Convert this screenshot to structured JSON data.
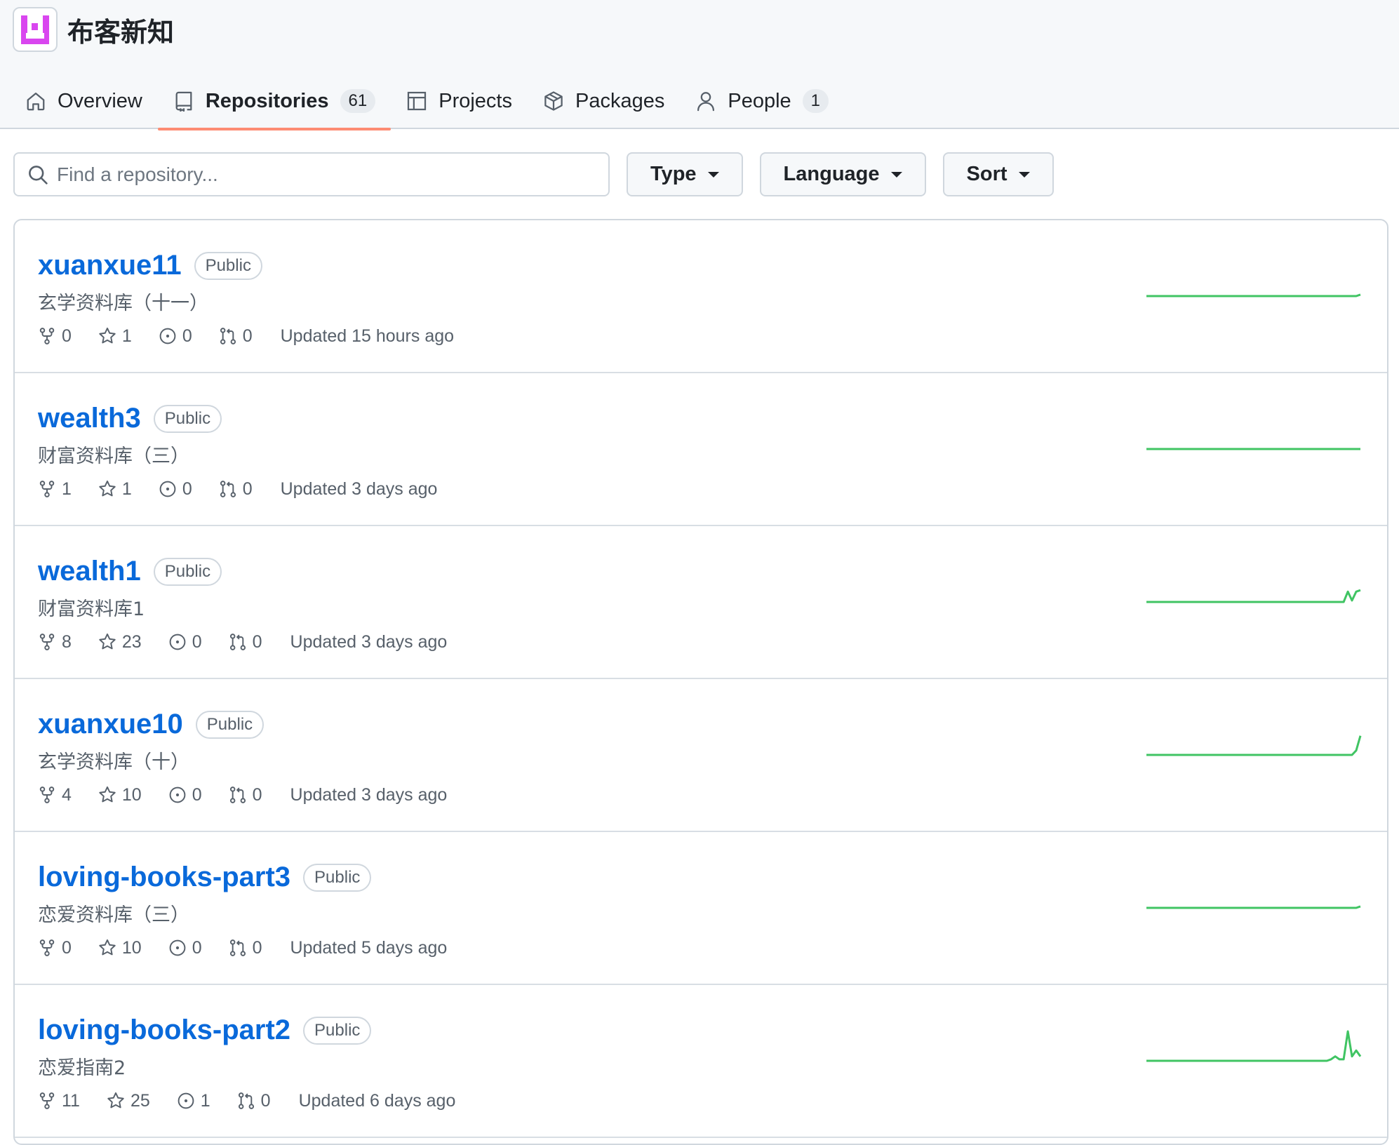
{
  "org": {
    "name": "布客新知",
    "logo_icon": "org-logo-icon"
  },
  "nav": {
    "tabs": [
      {
        "label": "Overview",
        "icon": "home-icon"
      },
      {
        "label": "Repositories",
        "icon": "repo-icon",
        "count": "61",
        "selected": true
      },
      {
        "label": "Projects",
        "icon": "table-icon"
      },
      {
        "label": "Packages",
        "icon": "package-icon"
      },
      {
        "label": "People",
        "icon": "person-icon",
        "count": "1"
      }
    ]
  },
  "filters": {
    "search_placeholder": "Find a repository...",
    "type_label": "Type",
    "language_label": "Language",
    "sort_label": "Sort"
  },
  "repos": [
    {
      "name": "xuanxue11",
      "visibility": "Public",
      "description": "玄学资料库（十一）",
      "forks": "0",
      "stars": "1",
      "issues": "0",
      "pulls": "0",
      "updated": "Updated 15 hours ago",
      "activity": [
        0,
        0,
        0,
        0,
        0,
        0,
        0,
        0,
        0,
        0,
        0,
        0,
        0,
        0,
        0,
        0,
        0,
        0,
        0,
        0,
        0,
        0,
        0,
        0,
        0,
        0,
        0,
        0,
        0,
        0,
        0,
        0,
        0,
        0,
        0,
        0,
        0,
        0,
        0,
        0,
        0,
        0,
        0,
        0,
        0,
        0,
        0,
        0,
        0,
        0,
        0,
        1
      ]
    },
    {
      "name": "wealth3",
      "visibility": "Public",
      "description": "财富资料库（三）",
      "forks": "1",
      "stars": "1",
      "issues": "0",
      "pulls": "0",
      "updated": "Updated 3 days ago",
      "activity": [
        0,
        0,
        0,
        0,
        0,
        0,
        0,
        0,
        0,
        0,
        0,
        0,
        0,
        0,
        0,
        0,
        0,
        0,
        0,
        0,
        0,
        0,
        0,
        0,
        0,
        0,
        0,
        0,
        0,
        0,
        0,
        0,
        0,
        0,
        0,
        0,
        0,
        0,
        0,
        0,
        0,
        0,
        0,
        0,
        0,
        0,
        0,
        0,
        0,
        0,
        0,
        0
      ]
    },
    {
      "name": "wealth1",
      "visibility": "Public",
      "description": "财富资料库1",
      "forks": "8",
      "stars": "23",
      "issues": "0",
      "pulls": "0",
      "updated": "Updated 3 days ago",
      "activity": [
        0,
        0,
        0,
        0,
        0,
        0,
        0,
        0,
        0,
        0,
        0,
        0,
        0,
        0,
        0,
        0,
        0,
        0,
        0,
        0,
        0,
        0,
        0,
        0,
        0,
        0,
        0,
        0,
        0,
        0,
        0,
        0,
        0,
        0,
        0,
        0,
        0,
        0,
        0,
        0,
        0,
        0,
        0,
        0,
        0,
        0,
        0,
        0,
        7,
        1,
        7,
        8
      ]
    },
    {
      "name": "xuanxue10",
      "visibility": "Public",
      "description": "玄学资料库（十）",
      "forks": "4",
      "stars": "10",
      "issues": "0",
      "pulls": "0",
      "updated": "Updated 3 days ago",
      "activity": [
        0,
        0,
        0,
        0,
        0,
        0,
        0,
        0,
        0,
        0,
        0,
        0,
        0,
        0,
        0,
        0,
        0,
        0,
        0,
        0,
        0,
        0,
        0,
        0,
        0,
        0,
        0,
        0,
        0,
        0,
        0,
        0,
        0,
        0,
        0,
        0,
        0,
        0,
        0,
        0,
        0,
        0,
        0,
        0,
        0,
        0,
        0,
        0,
        0,
        0,
        3,
        13
      ]
    },
    {
      "name": "loving-books-part3",
      "visibility": "Public",
      "description": "恋爱资料库（三）",
      "forks": "0",
      "stars": "10",
      "issues": "0",
      "pulls": "0",
      "updated": "Updated 5 days ago",
      "activity": [
        0,
        0,
        0,
        0,
        0,
        0,
        0,
        0,
        0,
        0,
        0,
        0,
        0,
        0,
        0,
        0,
        0,
        0,
        0,
        0,
        0,
        0,
        0,
        0,
        0,
        0,
        0,
        0,
        0,
        0,
        0,
        0,
        0,
        0,
        0,
        0,
        0,
        0,
        0,
        0,
        0,
        0,
        0,
        0,
        0,
        0,
        0,
        0,
        0,
        0,
        0,
        1
      ]
    },
    {
      "name": "loving-books-part2",
      "visibility": "Public",
      "description": "恋爱指南2",
      "forks": "11",
      "stars": "25",
      "issues": "1",
      "pulls": "0",
      "updated": "Updated 6 days ago",
      "activity": [
        0,
        0,
        0,
        0,
        0,
        0,
        0,
        0,
        0,
        0,
        0,
        0,
        0,
        0,
        0,
        0,
        0,
        0,
        0,
        0,
        0,
        0,
        0,
        0,
        0,
        0,
        0,
        0,
        0,
        0,
        0,
        0,
        0,
        0,
        0,
        0,
        0,
        0,
        0,
        0,
        0,
        0,
        0,
        0,
        1,
        3,
        1,
        1,
        20,
        3,
        7,
        3
      ]
    }
  ],
  "colors": {
    "link": "#0969da",
    "tab_underline": "#fd8c73",
    "sparkline": "#40c463",
    "logo": "#d946ef"
  }
}
